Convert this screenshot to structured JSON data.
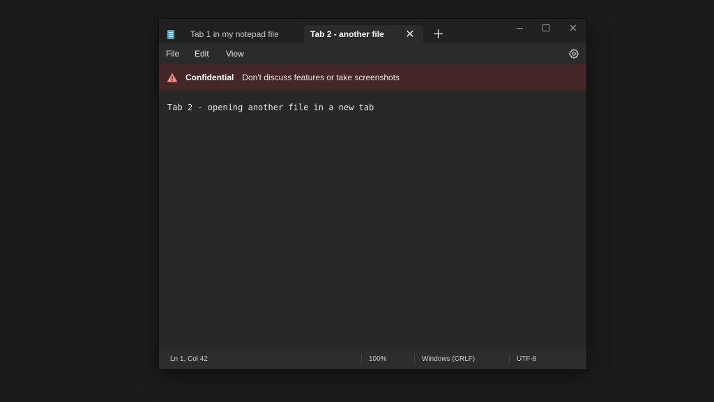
{
  "tabs": [
    {
      "label": "Tab 1 in my notepad file",
      "active": false
    },
    {
      "label": "Tab 2 - another file",
      "active": true
    }
  ],
  "window_controls": {
    "minimize": "minimize-icon",
    "maximize": "maximize-icon",
    "close": "close-icon"
  },
  "menu": {
    "items": [
      "File",
      "Edit",
      "View"
    ]
  },
  "banner": {
    "title": "Confidential",
    "message": "Don't discuss features or take screenshots",
    "color": "#442726"
  },
  "editor": {
    "content": "Tab 2 - opening another file in a new tab"
  },
  "status": {
    "position": "Ln 1, Col 42",
    "zoom": "100%",
    "line_ending": "Windows (CRLF)",
    "encoding": "UTF-8"
  },
  "colors": {
    "background": "#1b1b1b",
    "window": "#272727",
    "accent_icon": "#4fa6d8",
    "warning": "#f08a8a"
  }
}
